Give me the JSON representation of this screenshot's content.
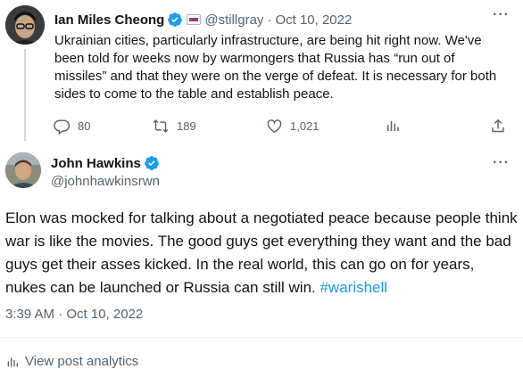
{
  "tweet_original": {
    "author_name": "Ian Miles Cheong",
    "handle": "@stillgray",
    "separator": "·",
    "date": "Oct 10, 2022",
    "body_lines": [
      "Ukrainian cities, particularly infrastructure, are being hit right now. We've",
      "been told for weeks now by warmongers that Russia has “run out of",
      "missiles” and that they were on the verge of defeat. It is necessary for both",
      "sides to come to the table and establish peace."
    ],
    "replies": "80",
    "retweets": "189",
    "likes": "1,021",
    "more_label": "···"
  },
  "tweet_reply": {
    "author_name": "John Hawkins",
    "handle": "@johnhawkinsrwn",
    "more_label": "···",
    "body_text": "Elon was mocked for talking about a negotiated peace because people think war is like the movies. The good guys get everything they want and the bad guys get their asses kicked. In the real world, this can go on for years, nukes can be launched or Russia can still win. ",
    "hashtag": "#warishell",
    "timestamp": "3:39 AM · Oct 10, 2022",
    "analytics_label": "View post analytics"
  },
  "colors": {
    "text_primary": "#0f1419",
    "text_secondary": "#536471",
    "accent": "#1d9bf0",
    "verified": "#1d9bf0"
  },
  "icons": {
    "verified": "verified-badge-icon",
    "reply": "reply-icon",
    "retweet": "retweet-icon",
    "like": "heart-icon",
    "views": "analytics-icon",
    "share": "share-icon",
    "more": "more-icon",
    "flag": "flag-icon"
  }
}
